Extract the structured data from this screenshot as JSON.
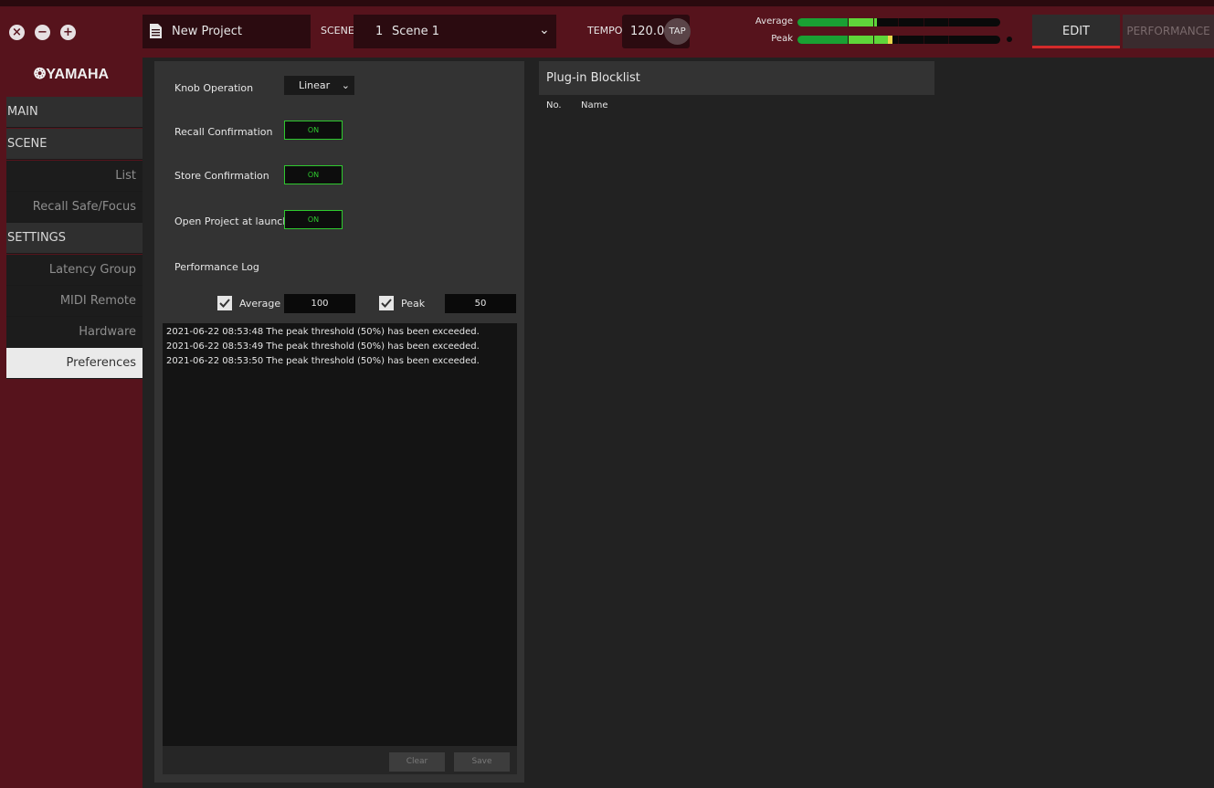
{
  "header": {
    "project_name": "New Project",
    "scene_label": "SCENE",
    "scene_number": "1",
    "scene_name": "Scene 1",
    "tempo_label": "TEMPO",
    "tempo_value": "120.0",
    "tap_label": "TAP",
    "meter_average_label": "Average",
    "meter_peak_label": "Peak",
    "meter_average_level": 0.39,
    "meter_peak_level": 0.47,
    "tabs": {
      "edit": "EDIT",
      "performance": "PERFORMANCE"
    },
    "active_tab": "EDIT"
  },
  "window_controls": [
    "close-icon",
    "minimize-icon",
    "maximize-icon"
  ],
  "sidebar": {
    "logo": "❂YAMAHA",
    "items": [
      {
        "label": "MAIN",
        "type": "section"
      },
      {
        "label": "SCENE",
        "type": "section"
      },
      {
        "label": "List",
        "type": "sub"
      },
      {
        "label": "Recall Safe/Focus",
        "type": "sub"
      },
      {
        "label": "SETTINGS",
        "type": "section"
      },
      {
        "label": "Latency Group",
        "type": "sub"
      },
      {
        "label": "MIDI Remote",
        "type": "sub"
      },
      {
        "label": "Hardware",
        "type": "sub"
      },
      {
        "label": "Preferences",
        "type": "sub",
        "active": true
      }
    ]
  },
  "preferences": {
    "knob_operation_label": "Knob Operation",
    "knob_operation_value": "Linear",
    "recall_confirmation_label": "Recall Confirmation",
    "recall_confirmation_value": "ON",
    "store_confirmation_label": "Store Confirmation",
    "store_confirmation_value": "ON",
    "open_project_label": "Open Project at launch",
    "open_project_value": "ON",
    "performance_log_label": "Performance Log",
    "average_checked": true,
    "average_label": "Average",
    "average_value": "100",
    "peak_checked": true,
    "peak_label": "Peak",
    "peak_value": "50",
    "log_lines": [
      "2021-06-22 08:53:48 The peak threshold (50%) has been exceeded.",
      "2021-06-22 08:53:49 The peak threshold (50%) has been exceeded.",
      "2021-06-22 08:53:50 The peak threshold (50%) has been exceeded."
    ],
    "clear_label": "Clear",
    "save_label": "Save"
  },
  "blocklist": {
    "title": "Plug-in Blocklist",
    "col_no": "No.",
    "col_name": "Name"
  },
  "colors": {
    "brand_maroon": "#5a1620",
    "toggle_green": "#2ec92e",
    "meter_green": "#1aa033",
    "meter_light_green": "#5fd63a",
    "meter_yellow": "#e8d64a",
    "edit_underline": "#d42a2a"
  }
}
